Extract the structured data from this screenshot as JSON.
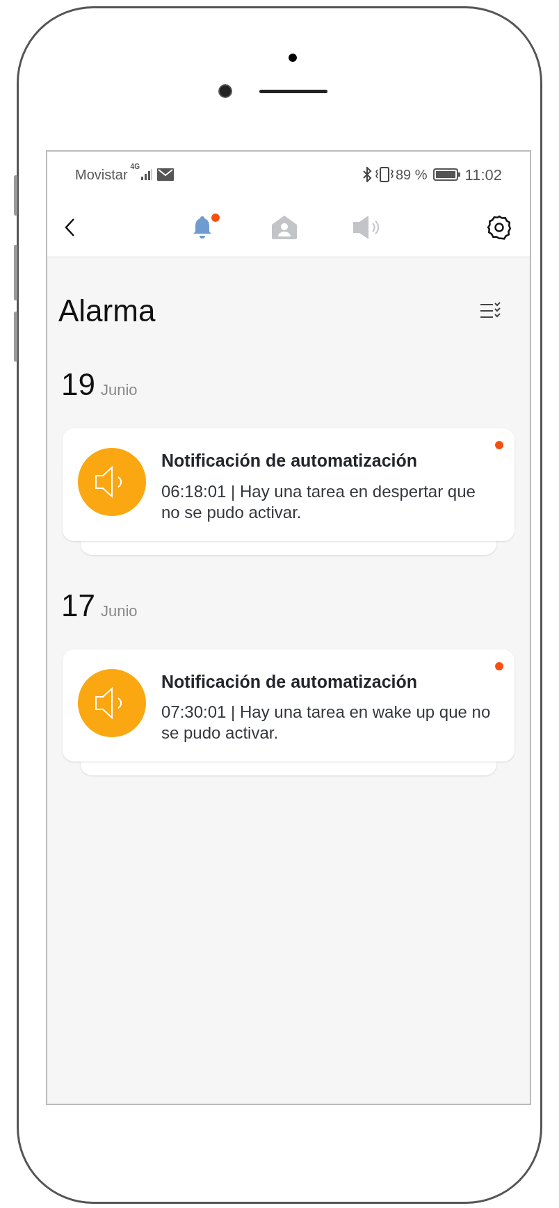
{
  "status_bar": {
    "carrier": "Movistar",
    "network": "4G",
    "battery": "89 %",
    "time": "11:02"
  },
  "nav": {
    "tabs": [
      {
        "kind": "alarm",
        "selected": true,
        "unread": true
      },
      {
        "kind": "home",
        "selected": false,
        "unread": false
      },
      {
        "kind": "sound",
        "selected": false,
        "unread": false
      }
    ]
  },
  "title": "Alarma",
  "groups": [
    {
      "day": "19",
      "month": "Junio",
      "notifications": [
        {
          "title": "Notificación de automatización",
          "text": "06:18:01 | Hay una tarea en despertar que no se pudo activar.",
          "unread": true
        }
      ]
    },
    {
      "day": "17",
      "month": "Junio",
      "notifications": [
        {
          "title": "Notificación de automatización",
          "text": "07:30:01 | Hay una tarea en wake up que no se pudo activar.",
          "unread": true
        }
      ]
    }
  ]
}
